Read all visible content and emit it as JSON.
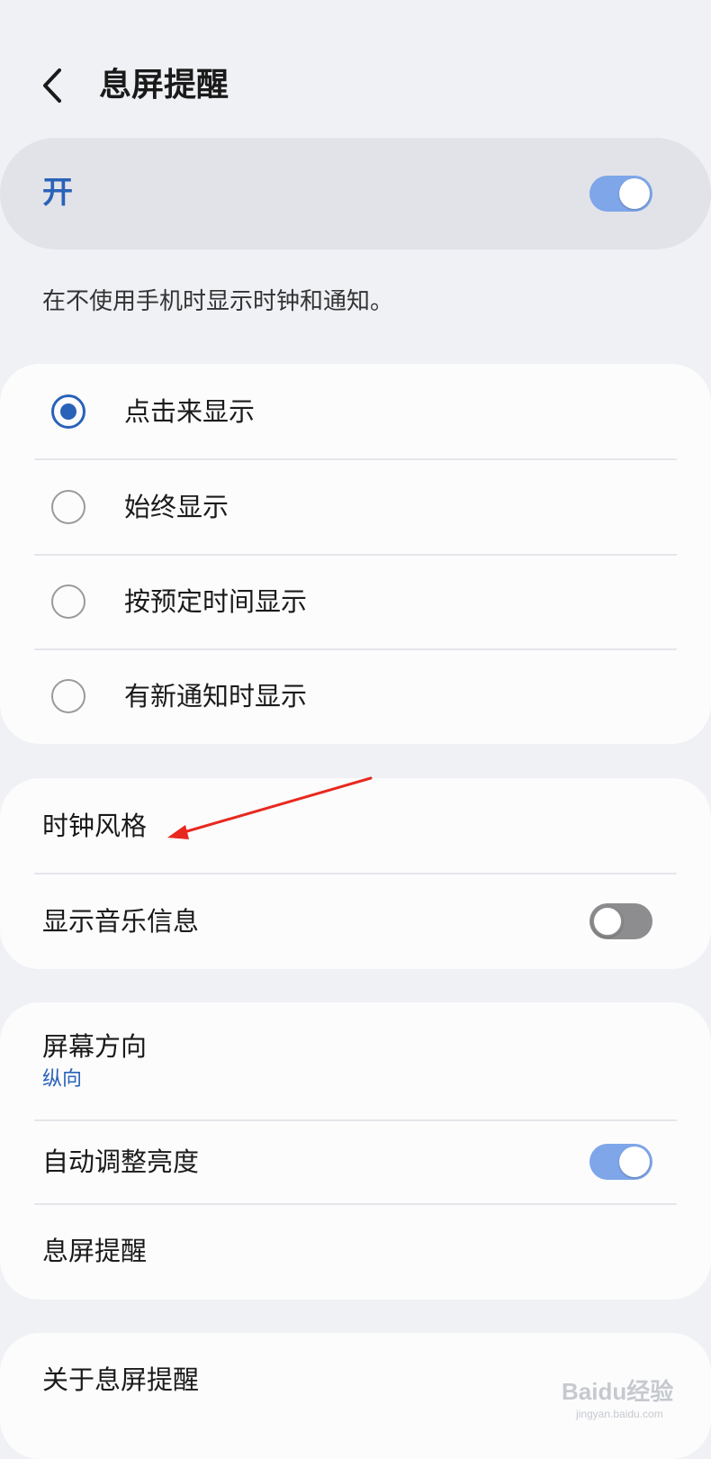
{
  "header": {
    "title": "息屏提醒",
    "back_icon": "chevron-left-icon"
  },
  "master_switch": {
    "label": "开",
    "state": true
  },
  "description": "在不使用手机时显示时钟和通知。",
  "display_mode": {
    "options": [
      {
        "label": "点击来显示",
        "selected": true
      },
      {
        "label": "始终显示",
        "selected": false
      },
      {
        "label": "按预定时间显示",
        "selected": false
      },
      {
        "label": "有新通知时显示",
        "selected": false
      }
    ]
  },
  "style_section": {
    "clock_style": "时钟风格",
    "music_info": {
      "label": "显示音乐信息",
      "state": false
    }
  },
  "display_section": {
    "orientation": {
      "label": "屏幕方向",
      "value": "纵向"
    },
    "auto_brightness": {
      "label": "自动调整亮度",
      "state": true
    },
    "aod_item": "息屏提醒"
  },
  "about": "关于息屏提醒",
  "colors": {
    "accent": "#2962b8",
    "toggle_on": "#7ea6e9",
    "toggle_off": "#8d8d8f",
    "background": "#f0f1f5",
    "annotation": "#e8281e"
  },
  "watermark": {
    "text": "Baidu经验",
    "subtext": "jingyan.baidu.com"
  }
}
